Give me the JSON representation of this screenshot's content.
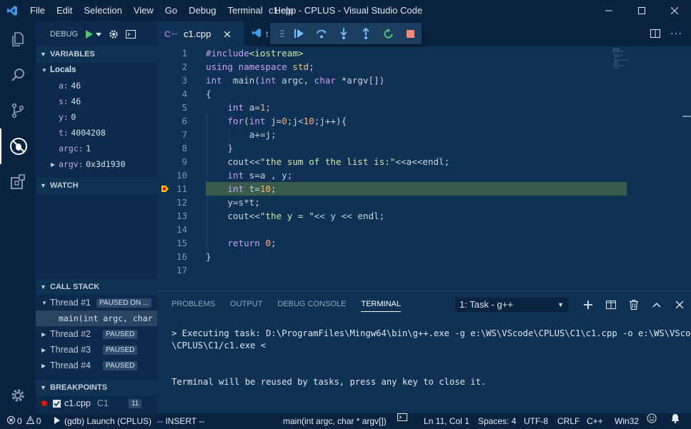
{
  "window": {
    "title": "c1.cpp - CPLUS - Visual Studio Code",
    "menu": [
      "File",
      "Edit",
      "Selection",
      "View",
      "Go",
      "Debug",
      "Terminal",
      "Help"
    ]
  },
  "debug": {
    "label": "DEBUG"
  },
  "variables": {
    "header": "VARIABLES",
    "locals_label": "Locals",
    "items": [
      {
        "name": "a:",
        "value": "46"
      },
      {
        "name": "s:",
        "value": "46"
      },
      {
        "name": "y:",
        "value": "0"
      },
      {
        "name": "t:",
        "value": "4004208"
      },
      {
        "name": "argc:",
        "value": "1"
      },
      {
        "name": "argv:",
        "value": "0x3d1930"
      }
    ]
  },
  "watch": {
    "header": "WATCH"
  },
  "callstack": {
    "header": "CALL STACK",
    "threads": [
      {
        "label": "Thread #1",
        "badge": "PAUSED ON ..."
      },
      {
        "label": "Thread #2",
        "badge": "PAUSED"
      },
      {
        "label": "Thread #3",
        "badge": "PAUSED"
      },
      {
        "label": "Thread #4",
        "badge": "PAUSED"
      }
    ],
    "frame": "main(int argc, char"
  },
  "breakpoints": {
    "header": "BREAKPOINTS",
    "file": "c1.cpp",
    "folder": "C1",
    "line": "11"
  },
  "tabs": {
    "active": "c1.cpp",
    "second": "t"
  },
  "editor": {
    "current_line": 11,
    "lines": [
      {
        "n": "1"
      },
      {
        "n": "2"
      },
      {
        "n": "3"
      },
      {
        "n": "4"
      },
      {
        "n": "5"
      },
      {
        "n": "6"
      },
      {
        "n": "7"
      },
      {
        "n": "8"
      },
      {
        "n": "9"
      },
      {
        "n": "10"
      },
      {
        "n": "11"
      },
      {
        "n": "12"
      },
      {
        "n": "13"
      },
      {
        "n": "14"
      },
      {
        "n": "15"
      },
      {
        "n": "16"
      },
      {
        "n": "17"
      }
    ]
  },
  "panel": {
    "tabs": [
      "PROBLEMS",
      "OUTPUT",
      "DEBUG CONSOLE",
      "TERMINAL"
    ],
    "active_tab": "TERMINAL",
    "terminal_select": "1: Task - g++",
    "terminal_line1": "> Executing task: D:\\ProgramFiles\\Mingw64\\bin\\g++.exe -g e:\\WS\\VScode\\CPLUS\\C1\\c1.cpp -o e:\\WS\\VScode",
    "terminal_line2": "\\CPLUS\\C1/c1.exe <",
    "terminal_line3": "Terminal will be reused by tasks, press any key to close it."
  },
  "statusbar": {
    "errors": "0",
    "warnings": "0",
    "launch": "(gdb) Launch (CPLUS)",
    "mode": "-- INSERT --",
    "function": "main(int argc, char * argv[])",
    "position": "Ln 11, Col 1",
    "spaces": "Spaces: 4",
    "encoding": "UTF-8",
    "eol": "CRLF",
    "language": "C++",
    "platform": "Win32"
  }
}
